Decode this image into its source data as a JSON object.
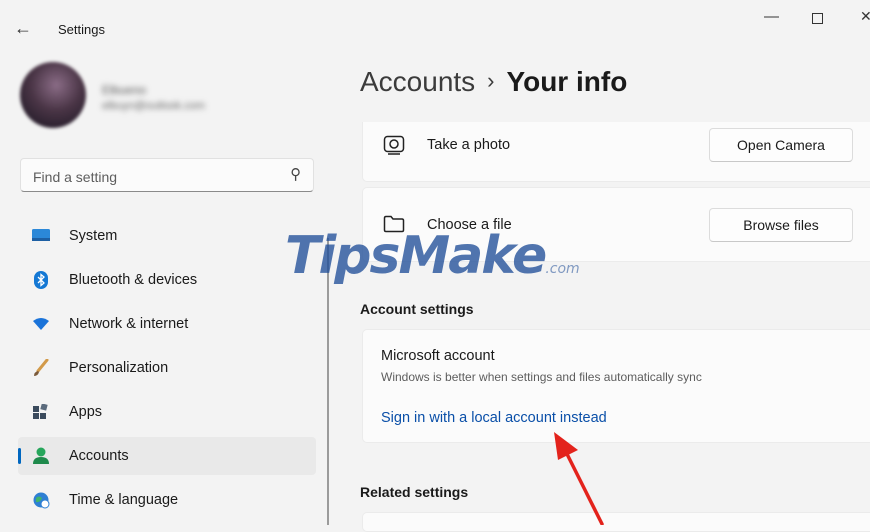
{
  "window": {
    "title": "Settings"
  },
  "profile": {
    "name": "Elbueno",
    "email": "elbuyn@outlook.com"
  },
  "search": {
    "placeholder": "Find a setting"
  },
  "nav": [
    {
      "label": "System",
      "icon": "system-icon",
      "active": false
    },
    {
      "label": "Bluetooth & devices",
      "icon": "bluetooth-icon",
      "active": false
    },
    {
      "label": "Network & internet",
      "icon": "network-icon",
      "active": false
    },
    {
      "label": "Personalization",
      "icon": "brush-icon",
      "active": false
    },
    {
      "label": "Apps",
      "icon": "apps-icon",
      "active": false
    },
    {
      "label": "Accounts",
      "icon": "person-icon",
      "active": true
    },
    {
      "label": "Time & language",
      "icon": "globe-clock-icon",
      "active": false
    }
  ],
  "header": {
    "parent": "Accounts",
    "separator": "›",
    "current": "Your info"
  },
  "photo_options": [
    {
      "label": "Take a photo",
      "button": "Open Camera",
      "icon": "camera-icon"
    },
    {
      "label": "Choose a file",
      "button": "Browse files",
      "icon": "folder-icon"
    }
  ],
  "account_settings": {
    "title": "Account settings",
    "microsoft_account": {
      "title": "Microsoft account",
      "description": "Windows is better when settings and files automatically sync",
      "link": "Sign in with a local account instead"
    }
  },
  "related_settings": {
    "title": "Related settings"
  },
  "watermark": {
    "main": "TipsMake",
    "suffix": ".com"
  },
  "colors": {
    "accent": "#0067c0",
    "link": "#0a4fa8",
    "arrow": "#e3231c"
  }
}
